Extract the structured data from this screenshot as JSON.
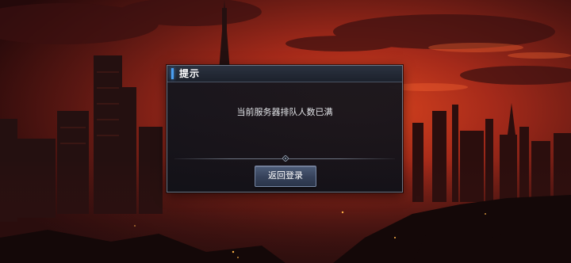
{
  "dialog": {
    "title": "提示",
    "message": "当前服务器排队人数已满",
    "button_label": "返回登录"
  },
  "colors": {
    "accent": "#4a9ef0",
    "sky_glow": "#c2321c",
    "dialog_bg": "#12161e",
    "button": "#3f4c66"
  },
  "icons": {
    "divider_ornament": "diamond-ornament-icon"
  }
}
